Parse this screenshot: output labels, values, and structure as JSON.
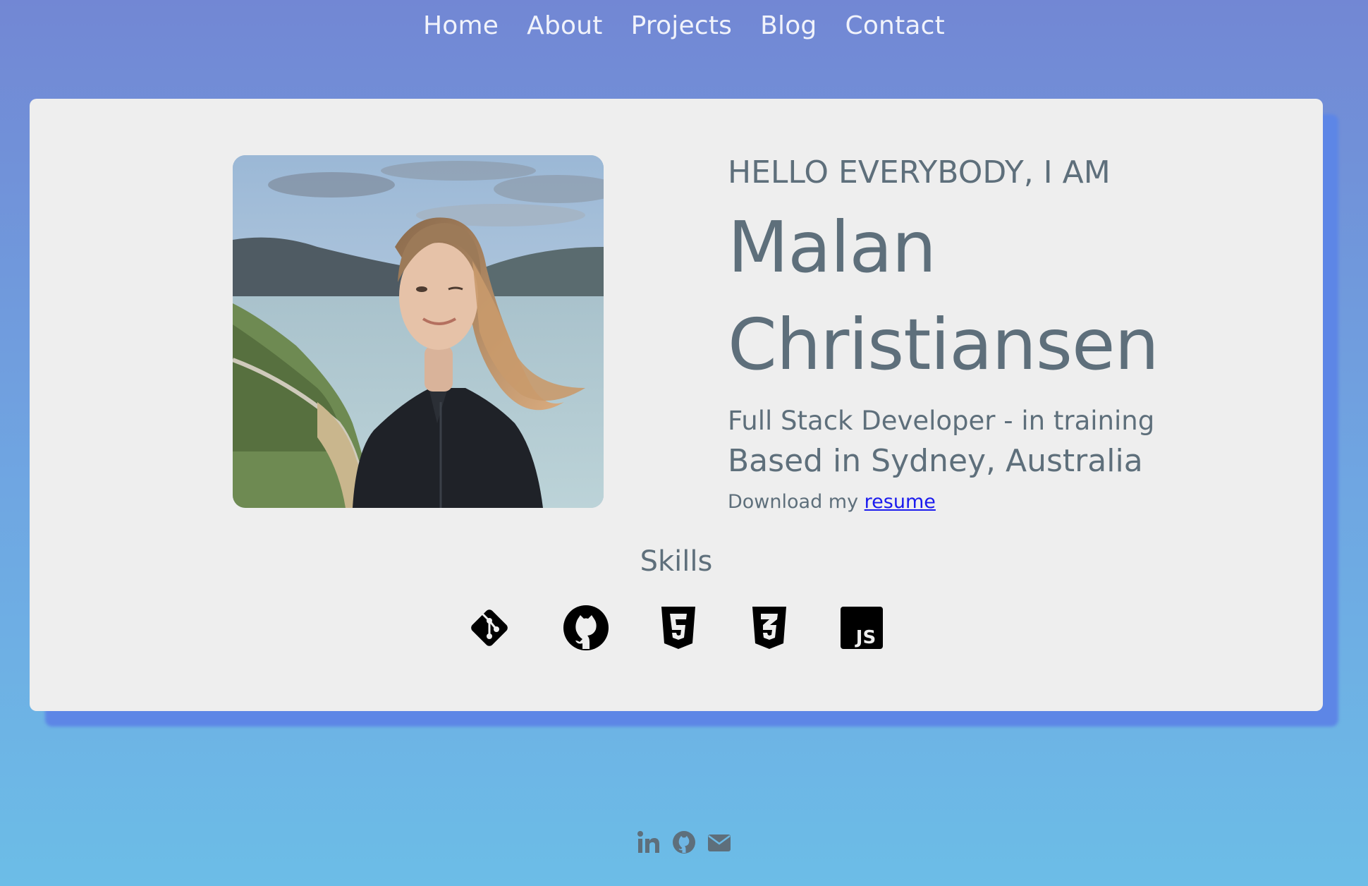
{
  "nav": {
    "items": [
      {
        "label": "Home"
      },
      {
        "label": "About"
      },
      {
        "label": "Projects"
      },
      {
        "label": "Blog"
      },
      {
        "label": "Contact"
      }
    ]
  },
  "hero": {
    "greeting": "HELLO EVERYBODY, I AM",
    "first_name": "Malan",
    "last_name": "Christiansen",
    "role": "Full Stack Developer - in training",
    "location": "Based in Sydney, Australia",
    "download_prefix": "Download my",
    "download_link": "resume"
  },
  "skills": {
    "title": "Skills",
    "icons": [
      "git-icon",
      "github-icon",
      "html5-icon",
      "css3-icon",
      "javascript-icon"
    ]
  },
  "footer": {
    "icons": [
      "linkedin-icon",
      "github-icon",
      "email-icon"
    ]
  },
  "colors": {
    "background_top": "#7287d4",
    "background_bottom": "#6cbde7",
    "card": "#eeeeee",
    "card_shadow": "#5d86e6",
    "text": "#5e6f7b",
    "link": "#1a1aee",
    "nav_text": "#f1f3fb"
  }
}
